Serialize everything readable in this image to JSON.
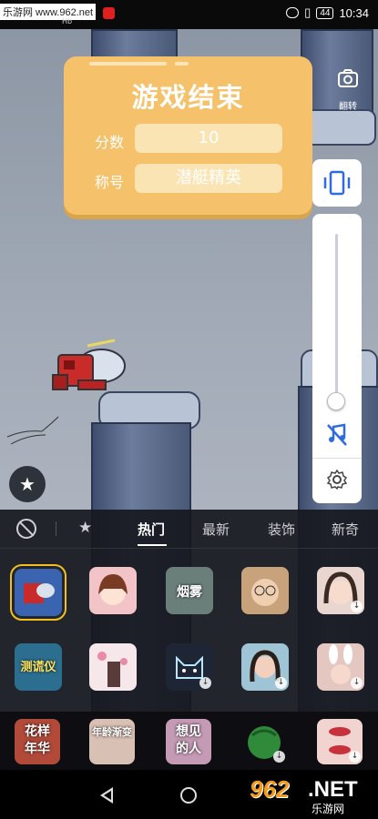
{
  "status_bar": {
    "watermark": "乐游网 www.962.net",
    "mini_text": "Hb",
    "battery": "44",
    "time": "10:34"
  },
  "result_card": {
    "title": "游戏结束",
    "score_label": "分数",
    "score_value": "10",
    "rank_label": "称号",
    "rank_value": "潜艇精英"
  },
  "side_controls": {
    "flip_label": "翻转",
    "slider_level": 0.1
  },
  "tabs": [
    "热门",
    "最新",
    "装饰",
    "新奇"
  ],
  "active_tab": "热门",
  "effects_row1": [
    {
      "icon": "submarine-game-icon",
      "label": "",
      "selected": true
    },
    {
      "icon": "cartoon-girl-icon",
      "label": ""
    },
    {
      "icon": "smoke-portrait-icon",
      "label": "烟雾"
    },
    {
      "icon": "glasses-man-icon",
      "label": ""
    },
    {
      "icon": "girl-portrait-icon",
      "label": "",
      "download": true
    }
  ],
  "effects_row2": [
    {
      "icon": "tester-icon",
      "label": "测谎仪"
    },
    {
      "icon": "blossom-girl-icon",
      "label": ""
    },
    {
      "icon": "neon-cat-icon",
      "label": "",
      "download": true
    },
    {
      "icon": "woman-portrait-icon",
      "label": "",
      "download": true
    },
    {
      "icon": "bunny-ears-icon",
      "label": "",
      "download": true
    }
  ],
  "bottom_row": [
    {
      "icon": "flower-year-icon",
      "label": "花样年华"
    },
    {
      "icon": "age-change-icon",
      "label": "年龄渐变"
    },
    {
      "icon": "miss-someone-icon",
      "label": "想见的人"
    },
    {
      "icon": "watermelon-icon",
      "label": "",
      "download": true
    },
    {
      "icon": "lips-icon",
      "label": "",
      "download": true
    }
  ],
  "brand": {
    "number": "962",
    "suffix": ".NET",
    "cn": "乐游网"
  },
  "colors": {
    "card": "#f5c26b",
    "accent_blue": "#2f6bdf",
    "selected_outline": "#f0c020",
    "brand_orange": "#f49a1c"
  }
}
